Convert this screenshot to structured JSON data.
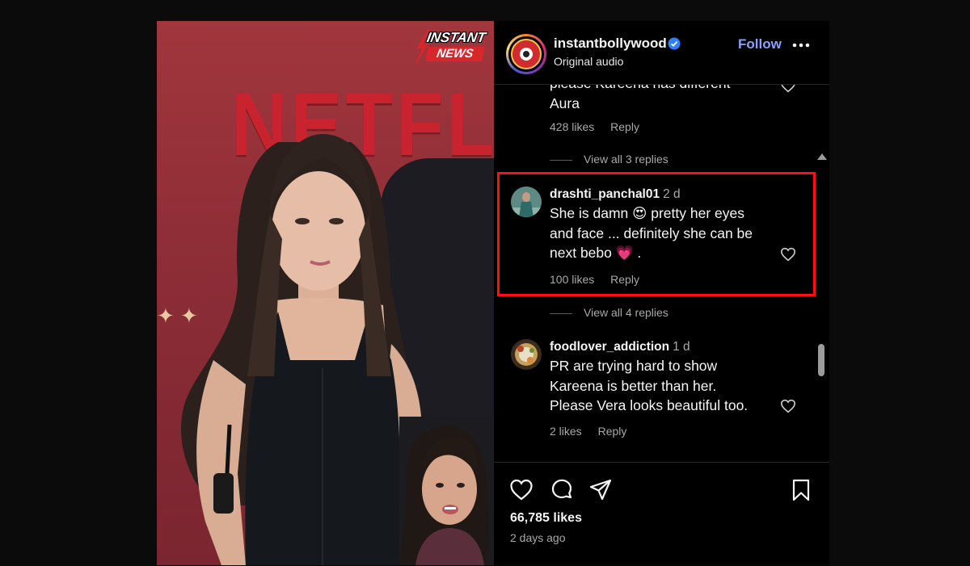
{
  "media": {
    "badge_line1": "INSTANT",
    "badge_line2": "NEWS",
    "backdrop_text": "NETFLI"
  },
  "post": {
    "username": "instantbollywood",
    "verified": true,
    "subtitle": "Original audio",
    "follow_label": "Follow",
    "likes": "66,785 likes",
    "posted": "2 days ago"
  },
  "comments": [
    {
      "text_lines": [
        "please Kareena has different",
        "Aura"
      ],
      "likes": "428 likes",
      "reply": "Reply",
      "view_replies": "View all 3 replies"
    },
    {
      "username": "drashti_panchal01",
      "time": "2 d",
      "text_lines": [
        "She is damn 😍 pretty her eyes",
        "and face ... definitely she can be",
        "next bebo 💗 ."
      ],
      "likes": "100 likes",
      "reply": "Reply",
      "view_replies": "View all 4 replies",
      "highlighted": true
    },
    {
      "username": "foodlover_addiction",
      "time": "1 d",
      "text_lines": [
        "PR are trying hard to show",
        "Kareena is better than her.",
        "Please Vera looks beautiful too."
      ],
      "likes": "2 likes",
      "reply": "Reply"
    }
  ],
  "colors": {
    "follow": "#8aa0ff",
    "verified": "#2f80ff",
    "highlight_border": "#ff1010",
    "media_bg": "#a1363d"
  },
  "icons": [
    "heart-icon",
    "comment-icon",
    "share-icon",
    "bookmark-icon",
    "more-icon",
    "verified-icon"
  ]
}
